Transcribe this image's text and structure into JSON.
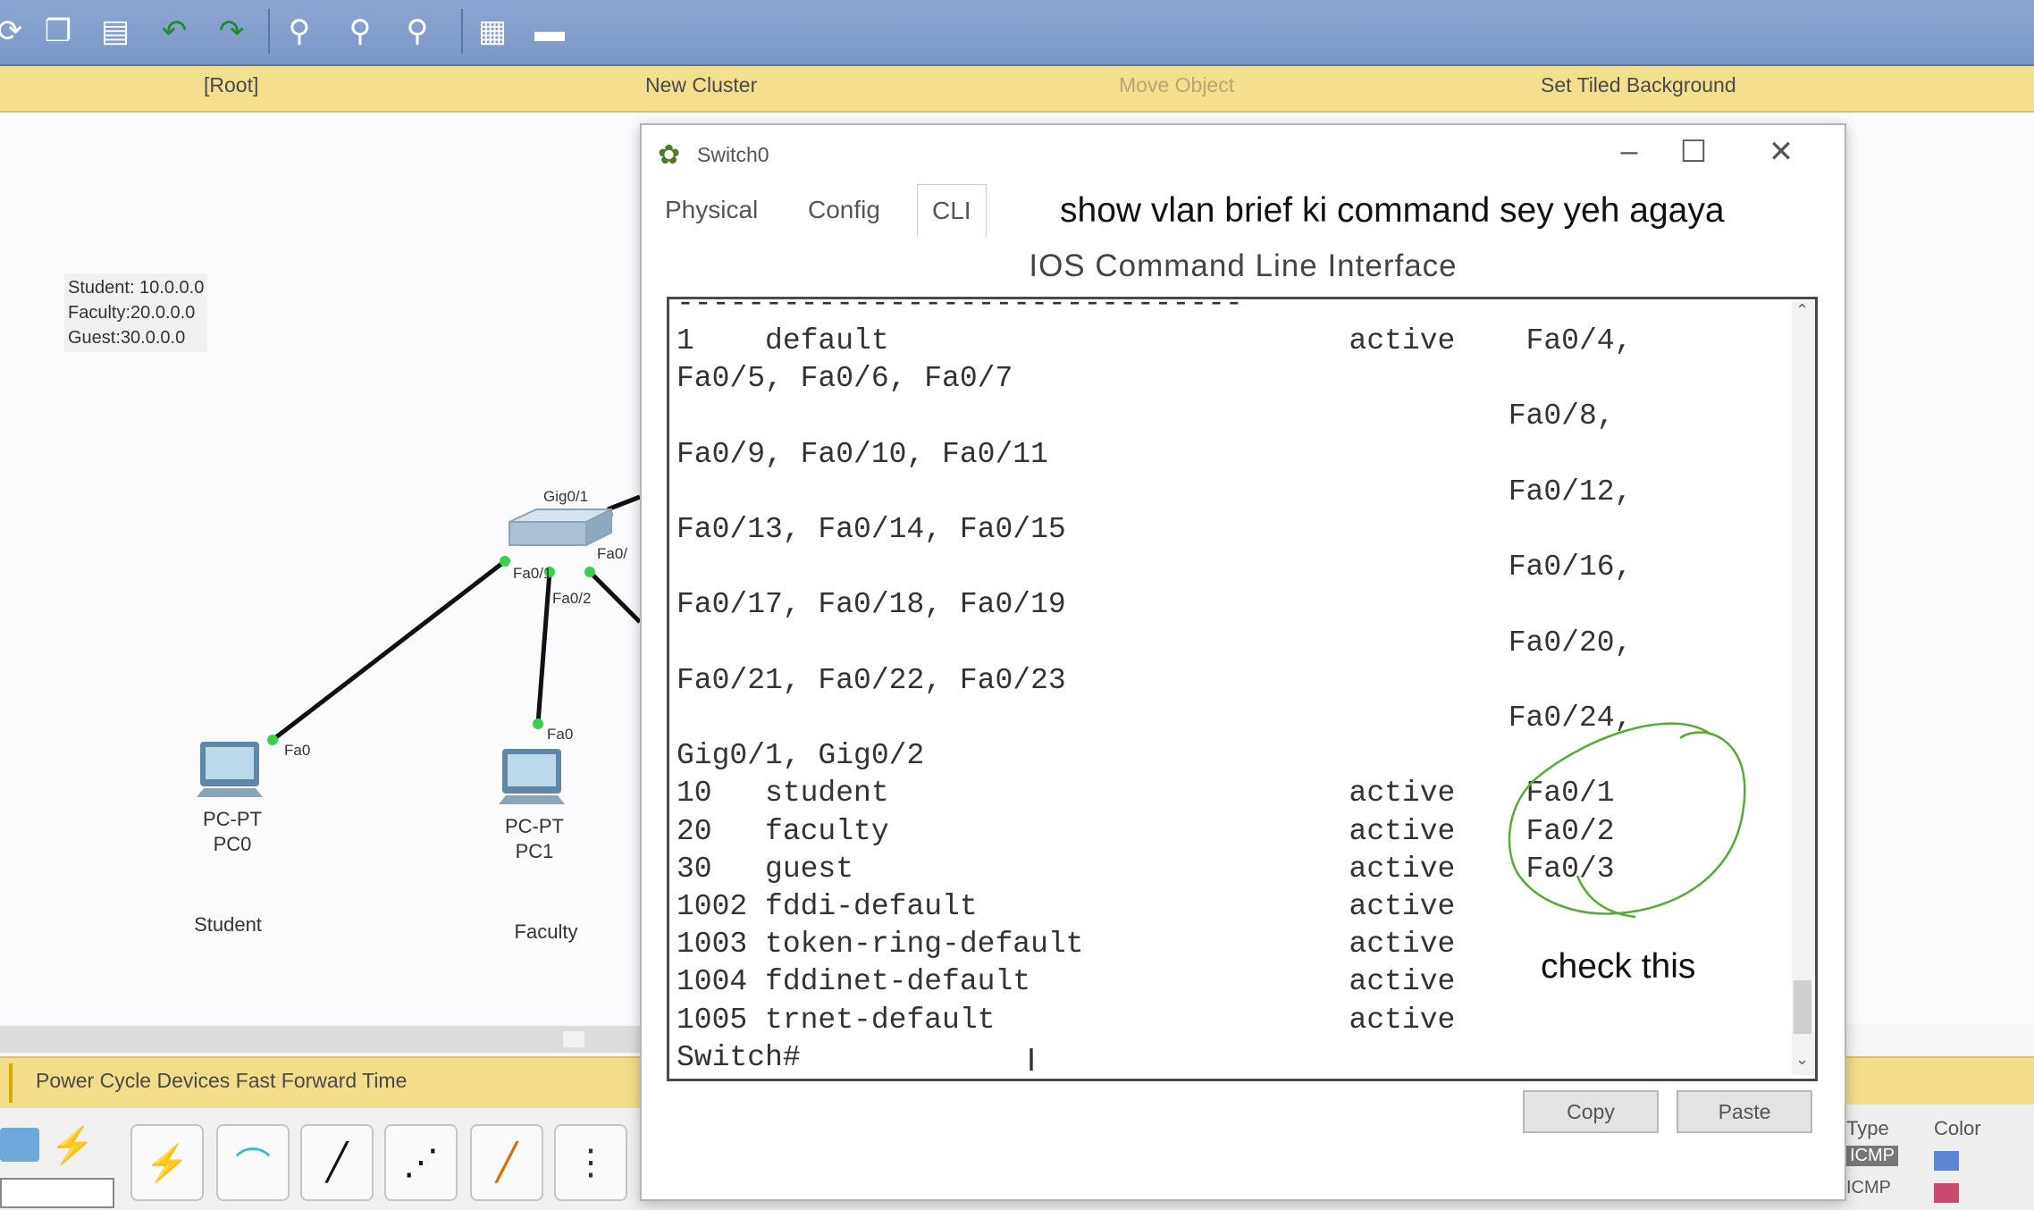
{
  "toolbar": {
    "icons": [
      "cycle-icon",
      "copy-icon",
      "paste-icon",
      "undo-icon",
      "redo-icon",
      "zoom-in-icon",
      "zoom-reset-icon",
      "zoom-out-icon",
      "palette-icon",
      "custom-device-icon"
    ]
  },
  "workspace_bar": {
    "root": "[Root]",
    "new_cluster": "New Cluster",
    "move_object": "Move Object",
    "set_background": "Set Tiled Background"
  },
  "topology": {
    "legend": [
      "Student: 10.0.0.0",
      "Faculty:20.0.0.0",
      "Guest:30.0.0.0"
    ],
    "switch_ports": {
      "gig": "Gig0/1",
      "fa1": "Fa0/1",
      "fa2": "Fa0/2",
      "fa_right": "Fa0/"
    },
    "pc0": {
      "model": "PC-PT",
      "name": "PC0",
      "port": "Fa0",
      "label": "Student"
    },
    "pc1": {
      "model": "PC-PT",
      "name": "PC1",
      "port": "Fa0",
      "label": "Faculty"
    }
  },
  "bottom_bar": {
    "text": "Power Cycle Devices  Fast Forward Time"
  },
  "window": {
    "title": "Switch0",
    "tabs": [
      "Physical",
      "Config",
      "CLI"
    ],
    "active_tab": "CLI",
    "heading": "IOS Command Line Interface",
    "copy": "Copy",
    "paste": "Paste"
  },
  "terminal": {
    "separator": "--------------------------------",
    "lines": [
      "1    default                          active    Fa0/4,",
      "Fa0/5, Fa0/6, Fa0/7",
      "                                               Fa0/8,",
      "Fa0/9, Fa0/10, Fa0/11",
      "                                               Fa0/12,",
      "Fa0/13, Fa0/14, Fa0/15",
      "                                               Fa0/16,",
      "Fa0/17, Fa0/18, Fa0/19",
      "                                               Fa0/20,",
      "Fa0/21, Fa0/22, Fa0/23",
      "                                               Fa0/24,",
      "Gig0/1, Gig0/2",
      "10   student                          active    Fa0/1",
      "20   faculty                          active    Fa0/2",
      "30   guest                            active    Fa0/3",
      "1002 fddi-default                     active",
      "1003 token-ring-default               active",
      "1004 fddinet-default                  active",
      "1005 trnet-default                    active",
      "Switch#"
    ]
  },
  "annotations": {
    "top": "show vlan brief ki command sey yeh agaya",
    "check": "check this"
  },
  "right_panel": {
    "type_header": "Type",
    "color_header": "Color",
    "rows": [
      "ICMP",
      "ICMP"
    ]
  },
  "colors": {
    "toolbar": "#7b96c8",
    "workspace_bar": "#f3df8d",
    "annotation_circle": "#5aa83a",
    "link_dot": "#39d14a"
  }
}
